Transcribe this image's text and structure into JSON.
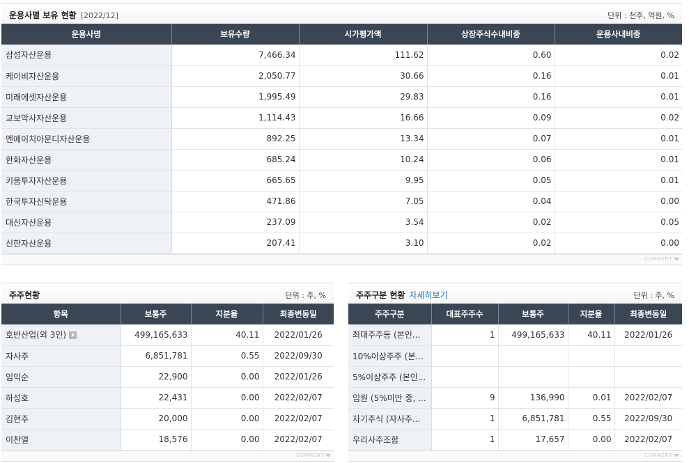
{
  "fund_holdings": {
    "title": "운용사별 보유 현황",
    "date": "[2022/12]",
    "unit": "단위 : 천주, 억원, %",
    "columns": [
      "운용사명",
      "보유수량",
      "시가평가액",
      "상장주식수내비중",
      "운용사내비중"
    ],
    "rows": [
      [
        "삼성자산운용",
        "7,466.34",
        "111.62",
        "0.60",
        "0.02"
      ],
      [
        "케이비자산운용",
        "2,050.77",
        "30.66",
        "0.16",
        "0.01"
      ],
      [
        "미래에셋자산운용",
        "1,995.49",
        "29.83",
        "0.16",
        "0.01"
      ],
      [
        "교보악사자산운용",
        "1,114.43",
        "16.66",
        "0.09",
        "0.02"
      ],
      [
        "엔에이치아문디자산운용",
        "892.25",
        "13.34",
        "0.07",
        "0.01"
      ],
      [
        "한화자산운용",
        "685.24",
        "10.24",
        "0.06",
        "0.01"
      ],
      [
        "키움투자자산운용",
        "665.65",
        "9.95",
        "0.05",
        "0.01"
      ],
      [
        "한국투자신탁운용",
        "471.86",
        "7.05",
        "0.04",
        "0.00"
      ],
      [
        "대신자산운용",
        "237.09",
        "3.54",
        "0.02",
        "0.05"
      ],
      [
        "신한자산운용",
        "207.41",
        "3.10",
        "0.02",
        "0.00"
      ]
    ],
    "comment": "COMMENT"
  },
  "shareholders": {
    "title": "주주현황",
    "unit": "단위 : 주, %",
    "columns": [
      "항목",
      "보통주",
      "지분율",
      "최종변동일"
    ],
    "rows": [
      [
        "호반산업(외 3인)",
        "499,165,633",
        "40.11",
        "2022/01/26"
      ],
      [
        "자사주",
        "6,851,781",
        "0.55",
        "2022/09/30"
      ],
      [
        "임익순",
        "22,900",
        "0.00",
        "2022/01/26"
      ],
      [
        "하성호",
        "22,431",
        "0.00",
        "2022/02/07"
      ],
      [
        "김현주",
        "20,000",
        "0.00",
        "2022/02/07"
      ],
      [
        "이찬열",
        "18,576",
        "0.00",
        "2022/02/07"
      ]
    ],
    "comment": "COMMENT"
  },
  "shareholder_types": {
    "title": "주주구분 현황",
    "link": "자세히보기",
    "unit": "단위 : 주, %",
    "columns": [
      "주주구분",
      "대표주주수",
      "보통주",
      "지분율",
      "최종변동일"
    ],
    "rows": [
      [
        "최대주주등 (본인...",
        "1",
        "499,165,633",
        "40.11",
        "2022/01/26"
      ],
      [
        "10%이상주주 (본...",
        "",
        "",
        "",
        ""
      ],
      [
        "5%이상주주 (본인...",
        "",
        "",
        "",
        ""
      ],
      [
        "임원 (5%미만 중, ...",
        "9",
        "136,990",
        "0.01",
        "2022/02/07"
      ],
      [
        "자기주식 (자사주...",
        "1",
        "6,851,781",
        "0.55",
        "2022/09/30"
      ],
      [
        "우리사주조합",
        "1",
        "17,657",
        "0.00",
        "2022/02/07"
      ]
    ],
    "comment": "COMMENT"
  },
  "colors": {
    "header_bg": "#3b4655",
    "name_cell_bg": "#eef1f6",
    "link": "#2a6db8"
  }
}
